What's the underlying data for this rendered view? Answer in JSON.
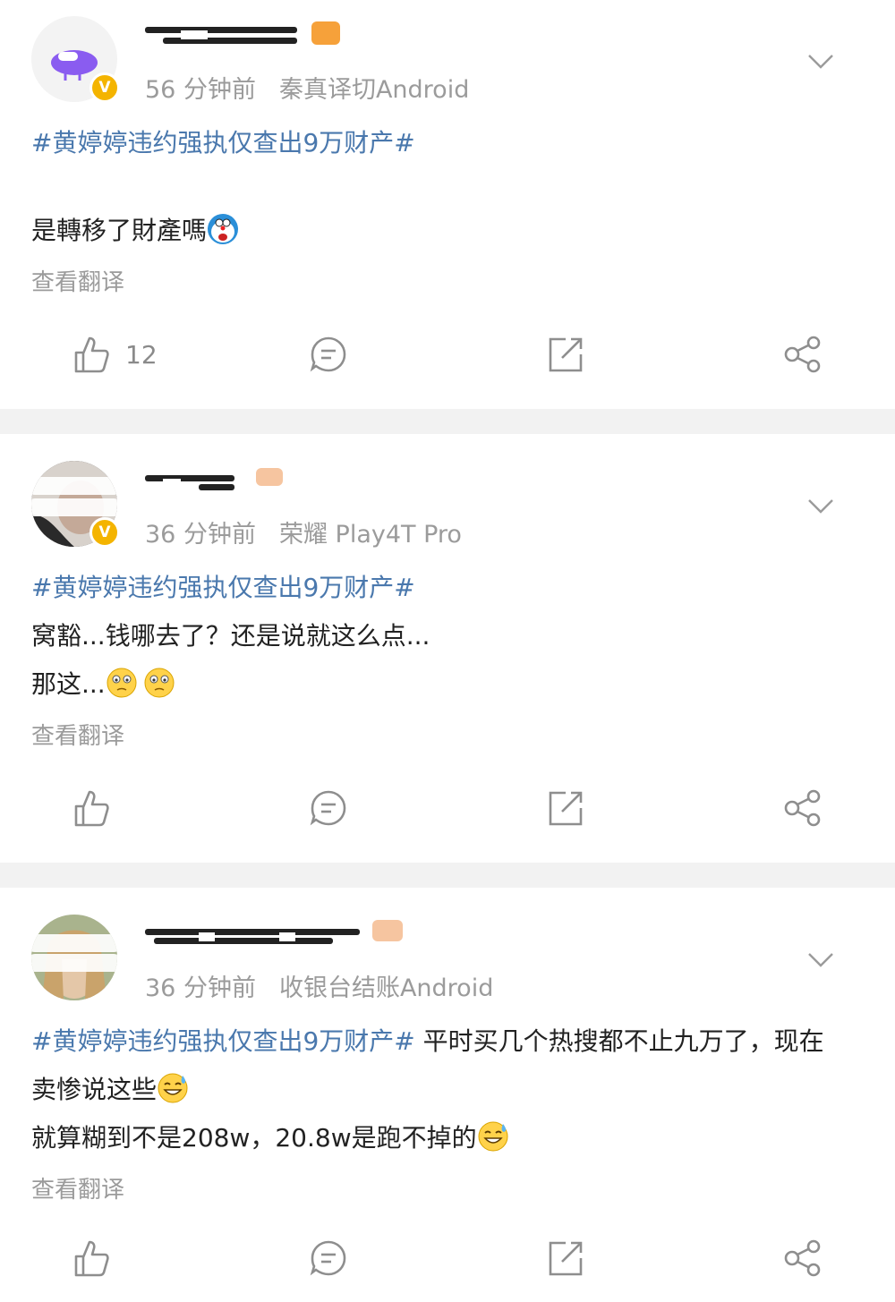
{
  "posts": [
    {
      "time": "56 分钟前",
      "device": "秦真译切Android",
      "tag": "#黄婷婷违约强执仅查出9万财产#",
      "lines": [
        "是轉移了財產嗎"
      ],
      "translate": "查看翻译",
      "likes": "12"
    },
    {
      "time": "36 分钟前",
      "device": "荣耀 Play4T Pro",
      "tag": "#黄婷婷违约强执仅查出9万财产#",
      "lines": [
        "窝豁...钱哪去了？还是说就这么点...",
        "那这..."
      ],
      "translate": "查看翻译",
      "likes": ""
    },
    {
      "time": "36 分钟前",
      "device": "收银台结账Android",
      "tag": "#黄婷婷违约强执仅查出9万财产#",
      "tag_after": " 平时买几个热搜都不止九万了，现在",
      "lines": [
        "卖惨说这些",
        "就算糊到不是208w，20.8w是跑不掉的"
      ],
      "translate": "查看翻译",
      "likes": ""
    }
  ],
  "icons": {
    "verified": "verified-badge-icon",
    "dropdown": "chevron-down-icon",
    "like": "thumbs-up-icon",
    "comment": "comment-icon",
    "repost": "repost-icon",
    "share": "share-icon"
  },
  "badge_letter": "V",
  "colors": {
    "topic": "#4a78ad",
    "meta": "#9b9b9b",
    "verified": "#f4b400",
    "separator": "#f2f2f2"
  }
}
